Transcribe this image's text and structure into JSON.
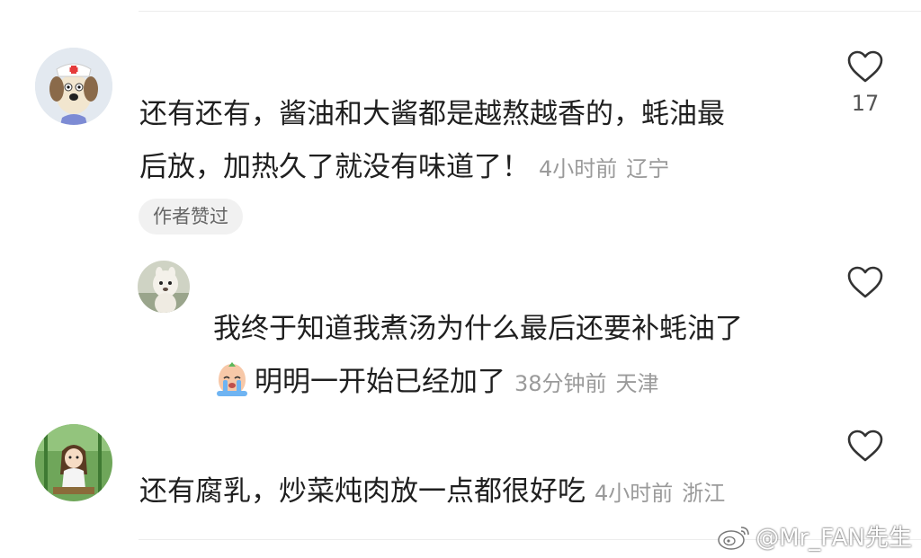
{
  "comments": [
    {
      "text_line1": "还有还有，酱油和大酱都是越熬越香的，蚝油最",
      "text_line2": "后放，加热久了就没有味道了！",
      "time": "4小时前",
      "location": "辽宁",
      "likes": "17",
      "badge": "作者赞过",
      "avatar_icon": "cartoon-dog-nurse-avatar"
    },
    {
      "text_line1": "我终于知道我煮汤为什么最后还要补蚝油了",
      "text_line2": "明明一开始已经加了",
      "time": "38分钟前",
      "location": "天津",
      "avatar_icon": "alpaca-avatar",
      "emoji_icon": "crying-peach-emoji"
    },
    {
      "text_line1": "还有腐乳，炒菜炖肉放一点都很好吃",
      "time": "4小时前",
      "location": "浙江",
      "avatar_icon": "anime-girl-avatar"
    }
  ],
  "watermark": {
    "text": "@Mr_FAN先生",
    "icon": "weibo-logo-icon"
  },
  "colors": {
    "text": "#1f1f1f",
    "meta": "#9a9a9a",
    "badge_bg": "#f1f1f1"
  }
}
